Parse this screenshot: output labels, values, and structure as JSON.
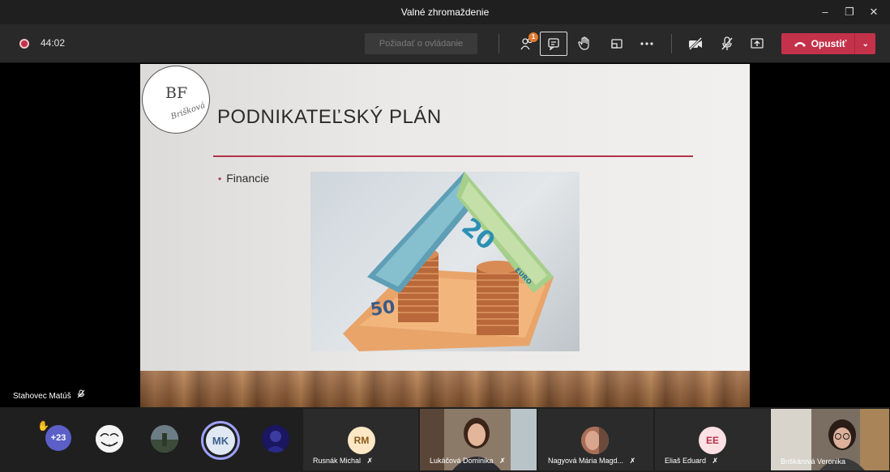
{
  "window": {
    "title": "Valné zhromaždenie",
    "minimize": "–",
    "restore": "❐",
    "close": "✕"
  },
  "toolbar": {
    "timer": "44:02",
    "request_control": "Požiadať o ovládanie",
    "participants_badge": "1",
    "leave_label": "Opustiť",
    "leave_color": "#c4314b"
  },
  "slide": {
    "logo_monogram": "BF",
    "logo_script": "Brišková",
    "title": "PODNIKATEĽSKÝ PLÁN",
    "bullets": [
      "Financie"
    ],
    "accent": "#b0344b"
  },
  "stage": {
    "speaker_name": "Stahovec Matúš"
  },
  "participants": {
    "overflow_count": "+23",
    "avatars": [
      {
        "initials": "MK"
      }
    ],
    "tiles": [
      {
        "name": "Rusnák Michal",
        "initials": "RM",
        "muted": true
      },
      {
        "name": "Lukáčová Dominika",
        "muted": true
      },
      {
        "name": "Nagyová Mária Magd...",
        "muted": true
      },
      {
        "name": "Eliaš Eduard",
        "initials": "EE",
        "muted": true
      },
      {
        "name": "Briškárová Veronika",
        "muted": false
      }
    ]
  }
}
